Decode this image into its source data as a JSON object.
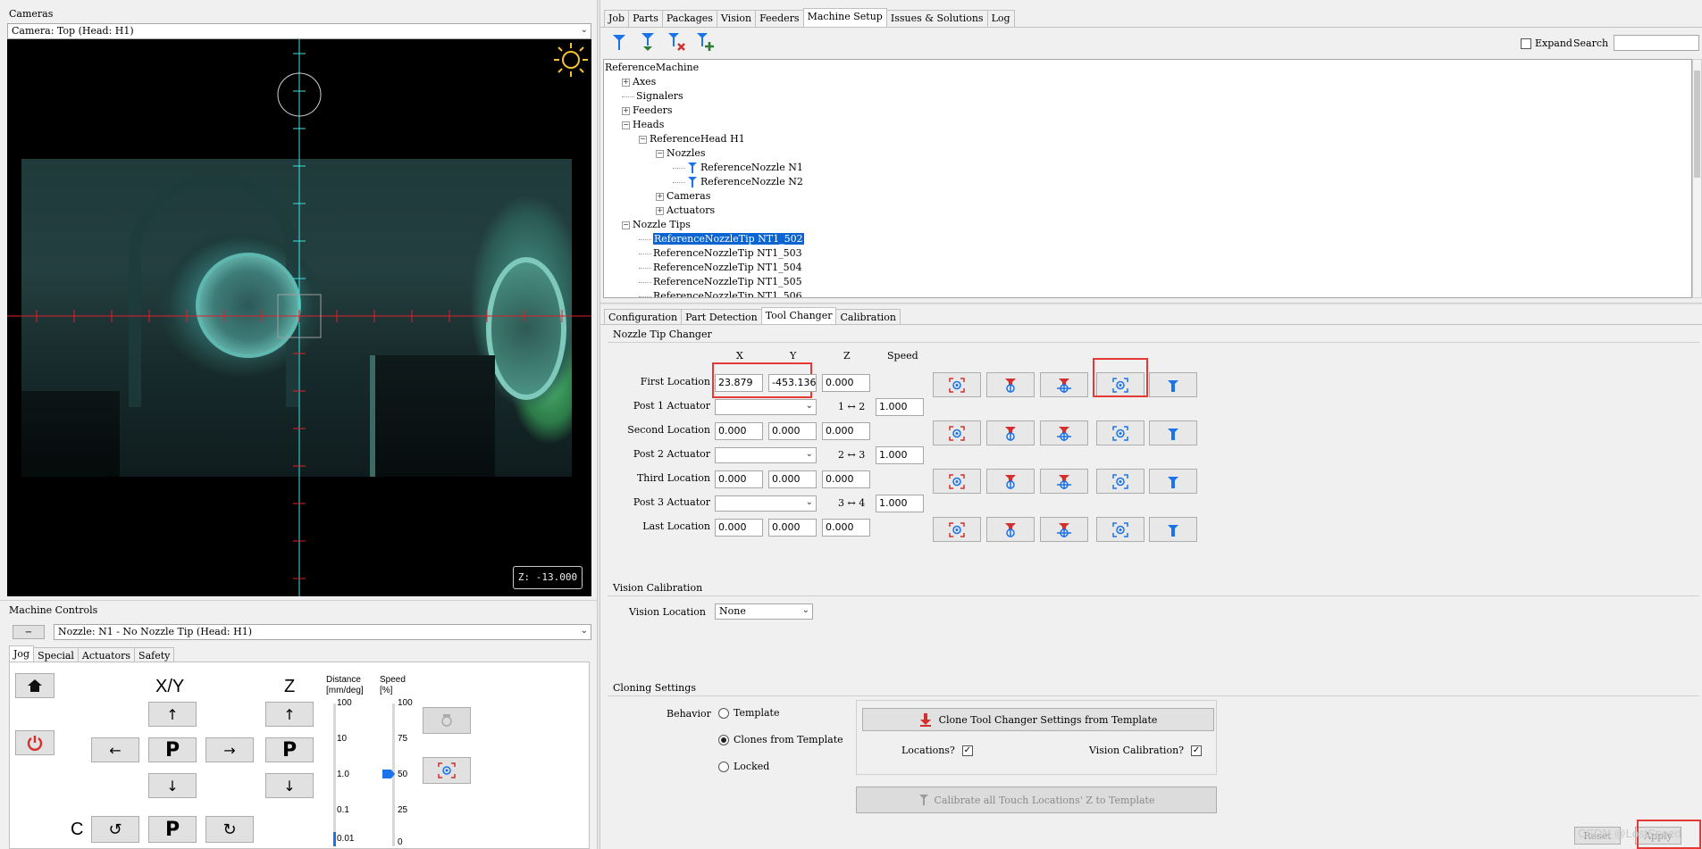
{
  "cameras": {
    "title": "Cameras",
    "selector": "Camera: Top (Head: H1)",
    "z_readout": "Z: -13.000"
  },
  "machine_controls": {
    "title": "Machine Controls",
    "collapse": "−",
    "nozzle_selector": "Nozzle: N1 - No Nozzle Tip (Head: H1)",
    "tabs": [
      "Jog",
      "Special",
      "Actuators",
      "Safety"
    ],
    "active_tab": "Jog",
    "xy_label": "X/Y",
    "z_label": "Z",
    "c_label": "C",
    "park_label": "P",
    "distance_label": "Distance",
    "distance_unit": "[mm/deg]",
    "speed_label": "Speed",
    "speed_unit": "[%]",
    "distance_ticks": [
      "100",
      "10",
      "1.0",
      "0.1",
      "0.01"
    ],
    "speed_ticks": [
      "100",
      "75",
      "50",
      "25",
      "0"
    ],
    "distance_value": "1.0",
    "speed_value": 50
  },
  "main_tabs": [
    "Job",
    "Parts",
    "Packages",
    "Vision",
    "Feeders",
    "Machine Setup",
    "Issues & Solutions",
    "Log"
  ],
  "active_main_tab": "Machine Setup",
  "toolbar": {
    "expand_label": "Expand",
    "search_label": "Search",
    "search_value": ""
  },
  "tree": [
    {
      "label": "ReferenceMachine",
      "indent": 0,
      "toggle": ""
    },
    {
      "label": "Axes",
      "indent": 1,
      "toggle": "+"
    },
    {
      "label": "Signalers",
      "indent": 1,
      "toggle": ""
    },
    {
      "label": "Feeders",
      "indent": 1,
      "toggle": "+"
    },
    {
      "label": "Heads",
      "indent": 1,
      "toggle": "-"
    },
    {
      "label": "ReferenceHead H1",
      "indent": 2,
      "toggle": "-"
    },
    {
      "label": "Nozzles",
      "indent": 3,
      "toggle": "-"
    },
    {
      "label": "ReferenceNozzle N1",
      "indent": 4,
      "toggle": "",
      "icon": "nozzle"
    },
    {
      "label": "ReferenceNozzle N2",
      "indent": 4,
      "toggle": "",
      "icon": "nozzle"
    },
    {
      "label": "Cameras",
      "indent": 3,
      "toggle": "+"
    },
    {
      "label": "Actuators",
      "indent": 3,
      "toggle": "+"
    },
    {
      "label": "Nozzle Tips",
      "indent": 1,
      "toggle": "-"
    },
    {
      "label": "ReferenceNozzleTip NT1_502",
      "indent": 2,
      "toggle": "",
      "selected": true
    },
    {
      "label": "ReferenceNozzleTip NT1_503",
      "indent": 2,
      "toggle": ""
    },
    {
      "label": "ReferenceNozzleTip NT1_504",
      "indent": 2,
      "toggle": ""
    },
    {
      "label": "ReferenceNozzleTip NT1_505",
      "indent": 2,
      "toggle": ""
    },
    {
      "label": "ReferenceNozzleTip NT1_506",
      "indent": 2,
      "toggle": ""
    }
  ],
  "sub_tabs": [
    "Configuration",
    "Part Detection",
    "Tool Changer",
    "Calibration"
  ],
  "active_sub_tab": "Tool Changer",
  "nozzle_tip_changer": {
    "title": "Nozzle Tip Changer",
    "col_x": "X",
    "col_y": "Y",
    "col_z": "Z",
    "col_speed": "Speed",
    "rows": [
      {
        "label": "First Location",
        "x": "23.879",
        "y": "-453.136",
        "z": "0.000"
      },
      {
        "label": "Post 1 Actuator",
        "actuator": "",
        "pair": "1 ↔ 2",
        "speed": "1.000"
      },
      {
        "label": "Second Location",
        "x": "0.000",
        "y": "0.000",
        "z": "0.000"
      },
      {
        "label": "Post 2 Actuator",
        "actuator": "",
        "pair": "2 ↔ 3",
        "speed": "1.000"
      },
      {
        "label": "Third Location",
        "x": "0.000",
        "y": "0.000",
        "z": "0.000"
      },
      {
        "label": "Post 3 Actuator",
        "actuator": "",
        "pair": "3 ↔ 4",
        "speed": "1.000"
      },
      {
        "label": "Last Location",
        "x": "0.000",
        "y": "0.000",
        "z": "0.000"
      }
    ]
  },
  "vision_calibration": {
    "title": "Vision Calibration",
    "location_label": "Vision Location",
    "location_value": "None"
  },
  "cloning": {
    "title": "Cloning Settings",
    "behavior_label": "Behavior",
    "options": [
      "Template",
      "Clones from Template",
      "Locked"
    ],
    "selected": "Clones from Template",
    "clone_button": "Clone Tool Changer Settings from Template",
    "locations_label": "Locations?",
    "vision_calibration_label": "Vision Calibration?",
    "calibrate_button": "Calibrate all Touch Locations' Z to Template"
  },
  "footer": {
    "reset": "Reset",
    "apply": "Apply",
    "watermark": "CSDN @LostSpeed"
  },
  "colors": {
    "accent_blue": "#1a73e8",
    "icon_red": "#d32f2f",
    "highlight_red": "#e53935",
    "selection": "#0a64d2",
    "crosshair_red": "#e0202a",
    "crosshair_cyan": "#40e0e0"
  }
}
